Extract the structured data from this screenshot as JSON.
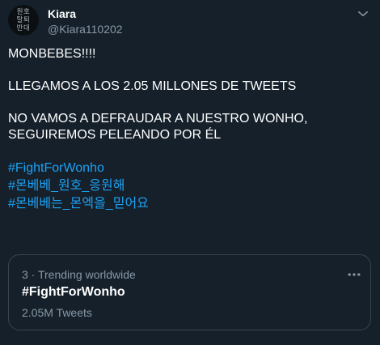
{
  "user": {
    "display_name": "Kiara",
    "handle": "@Kiara110202",
    "avatar_lines": [
      "원호",
      "탈퇴",
      "반대"
    ]
  },
  "tweet": {
    "line1": "MONBEBES!!!!",
    "line2": "LLEGAMOS A LOS 2.05 MILLONES DE TWEETS",
    "line3": "NO VAMOS A DEFRAUDAR A NUESTRO WONHO, SEGUIREMOS PELEANDO POR ÉL",
    "hashtags": [
      "#FightForWonho",
      "#몬베베_원호_응원해",
      "#몬베베는_몬엑을_믿어요"
    ]
  },
  "trend": {
    "meta": "3 · Trending worldwide",
    "name": "#FightForWonho",
    "count": "2.05M Tweets"
  },
  "icons": {
    "chevron": "chevron-down-icon",
    "more": "more-horizontal-icon"
  },
  "colors": {
    "background": "#15202b",
    "link": "#1da1f2",
    "secondary_text": "#8899a6",
    "border": "#38444d"
  }
}
